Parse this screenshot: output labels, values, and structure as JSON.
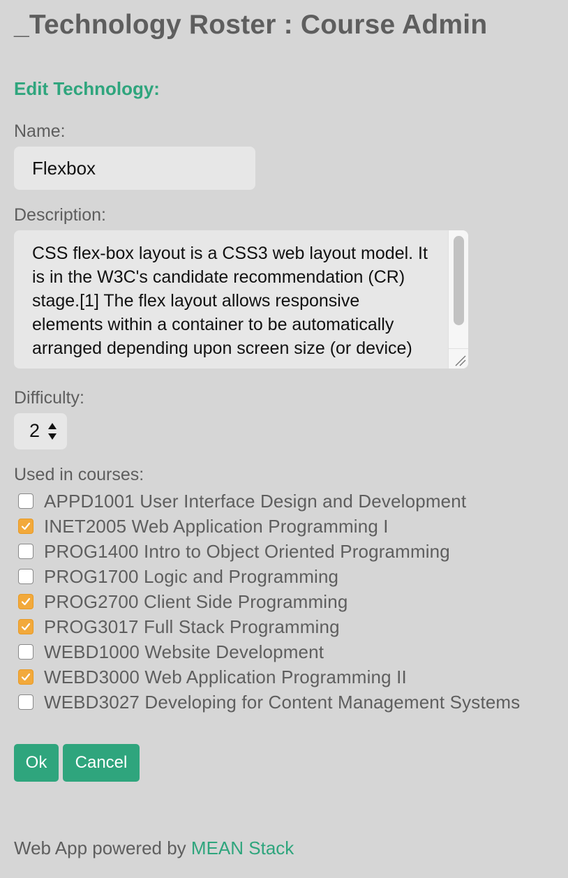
{
  "header": {
    "title": "_Technology Roster : Course Admin"
  },
  "form": {
    "heading": "Edit Technology:",
    "name_label": "Name:",
    "name_value": "Flexbox",
    "description_label": "Description:",
    "description_value": "CSS flex-box layout is a CSS3 web layout model. It is in the W3C's candidate recommendation (CR) stage.[1] The flex layout allows responsive elements within a container to be automatically arranged depending upon screen size (or device)",
    "difficulty_label": "Difficulty:",
    "difficulty_value": "2",
    "courses_label": "Used in courses:",
    "courses": [
      {
        "label": "APPD1001 User Interface Design and Development",
        "checked": false
      },
      {
        "label": "INET2005 Web Application Programming I",
        "checked": true
      },
      {
        "label": "PROG1400 Intro to Object Oriented Programming",
        "checked": false
      },
      {
        "label": "PROG1700 Logic and Programming",
        "checked": false
      },
      {
        "label": "PROG2700 Client Side Programming",
        "checked": true
      },
      {
        "label": "PROG3017 Full Stack Programming",
        "checked": true
      },
      {
        "label": "WEBD1000 Website Development",
        "checked": false
      },
      {
        "label": "WEBD3000 Web Application Programming II",
        "checked": true
      },
      {
        "label": "WEBD3027 Developing for Content Management Systems",
        "checked": false
      }
    ],
    "ok_label": "Ok",
    "cancel_label": "Cancel"
  },
  "footer": {
    "prefix": "Web App powered by ",
    "link_label": "MEAN Stack"
  },
  "colors": {
    "accent": "#2fa57d",
    "checkbox_checked": "#f2a93b",
    "background": "#d6d6d6"
  },
  "icons": {
    "checkmark": "check-icon",
    "spinner": "stepper-arrows-icon",
    "resize": "resize-grip-icon"
  }
}
